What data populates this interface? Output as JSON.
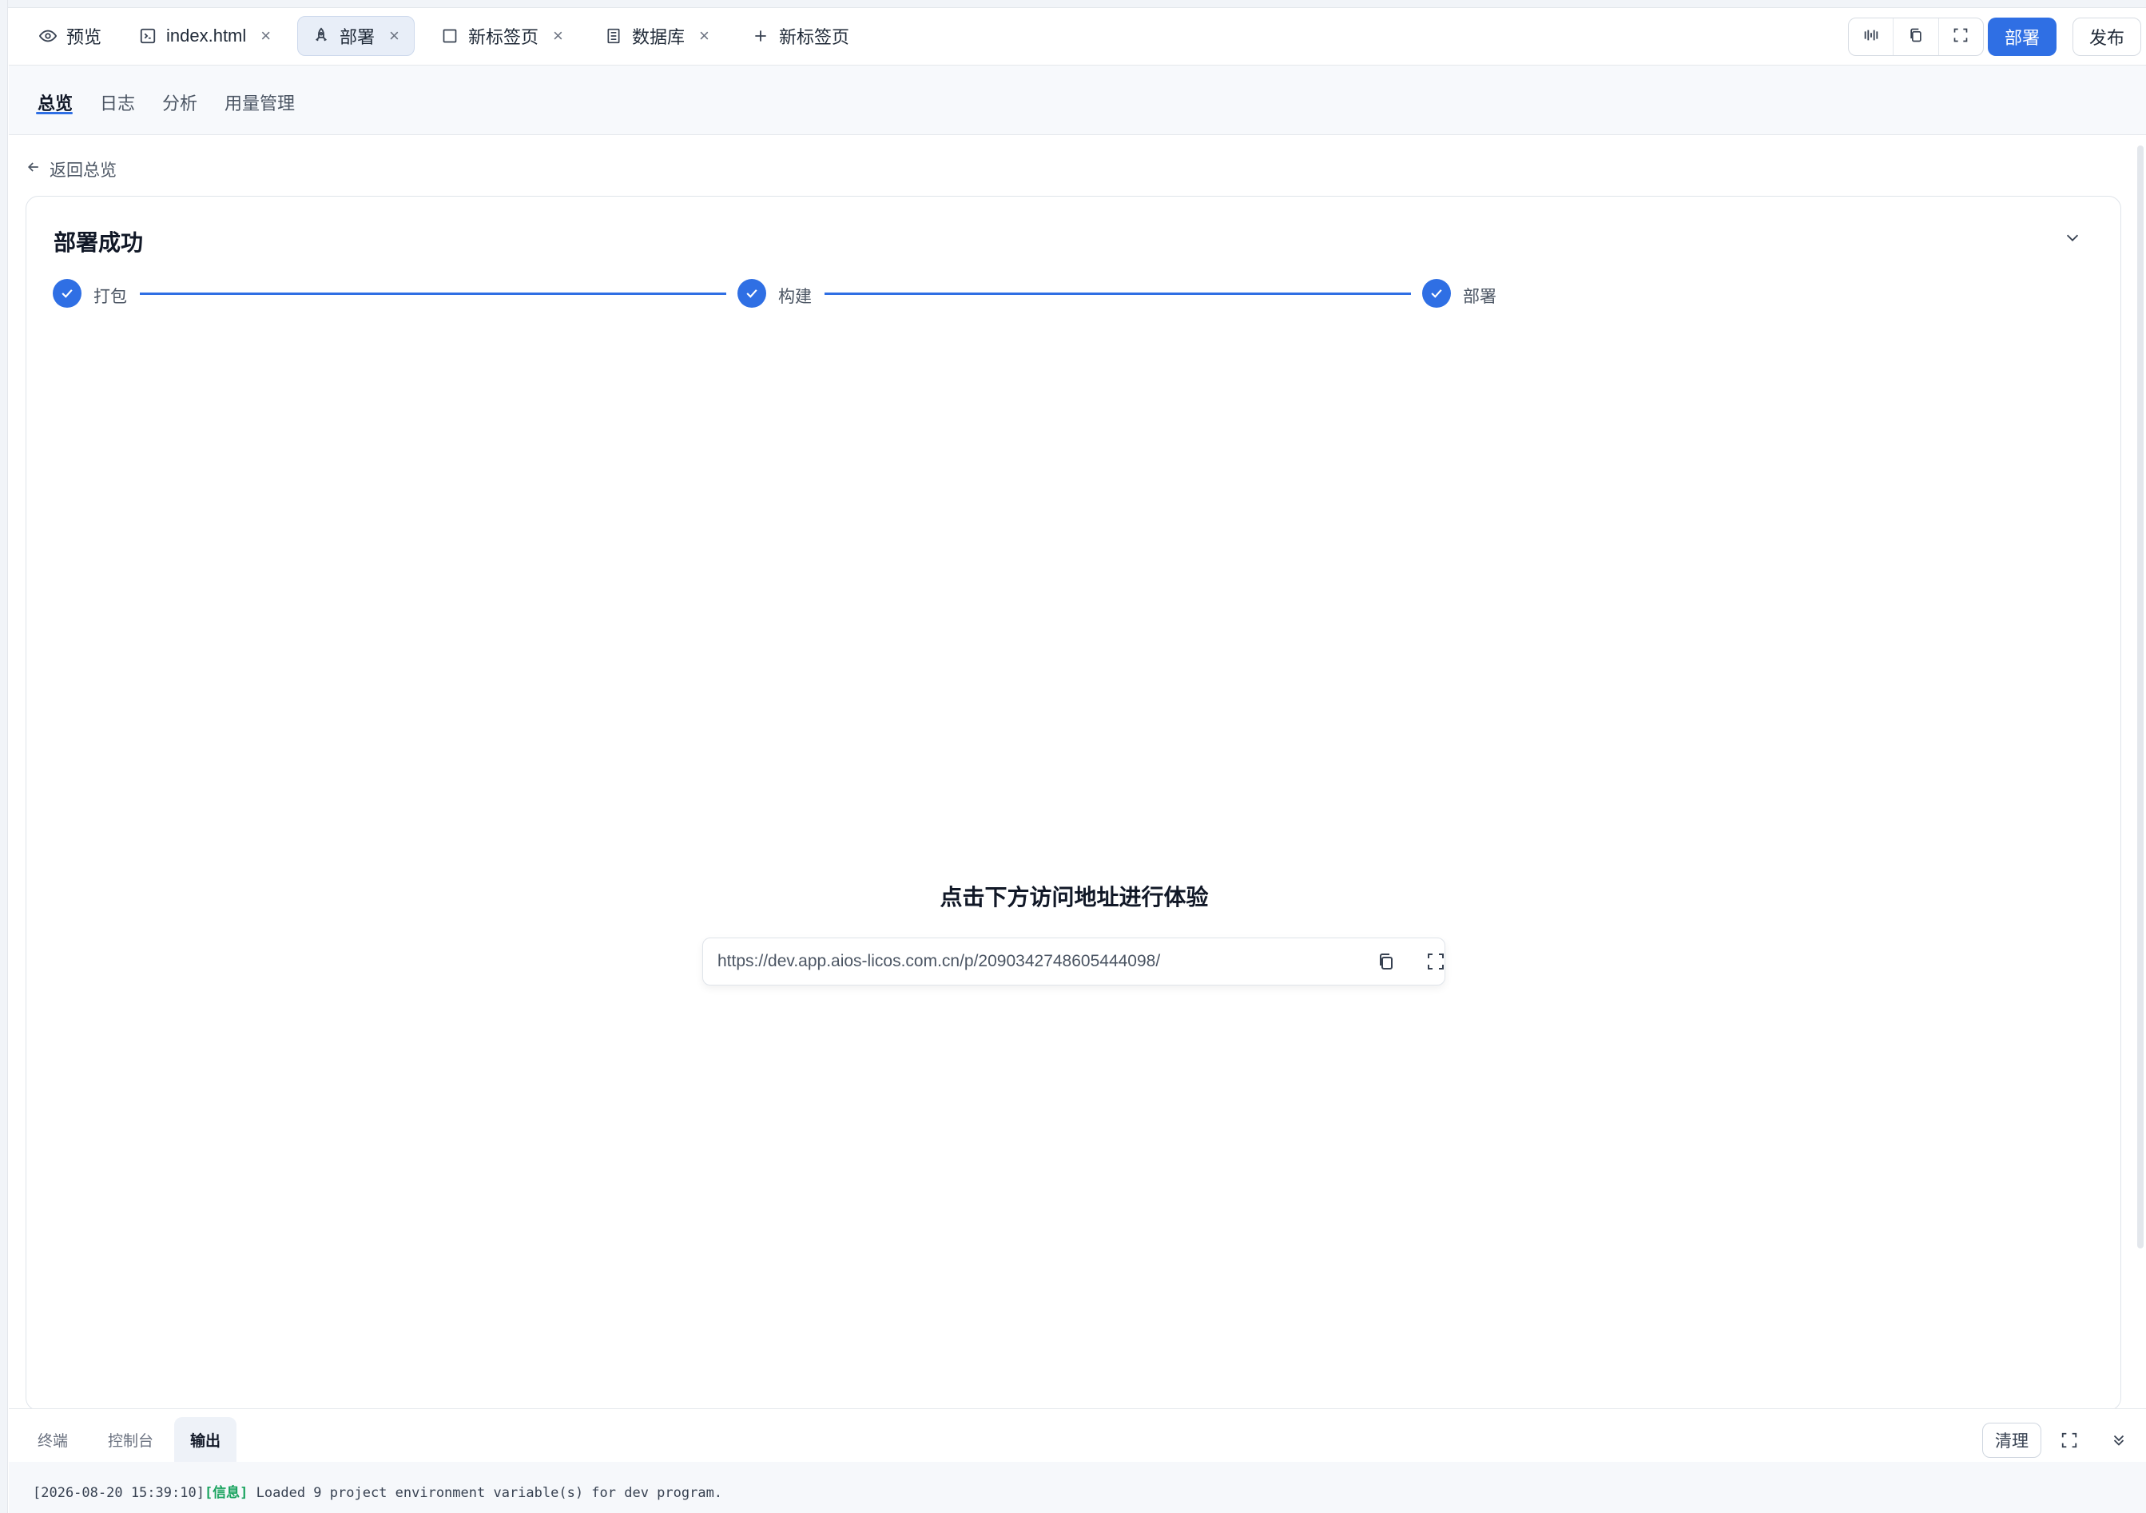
{
  "tabs": [
    {
      "label": "预览",
      "icon": "eye-icon",
      "closable": false,
      "active": false
    },
    {
      "label": "index.html",
      "icon": "terminal-file-icon",
      "closable": true,
      "active": false
    },
    {
      "label": "部署",
      "icon": "rocket-icon",
      "closable": true,
      "active": true
    },
    {
      "label": "新标签页",
      "icon": "square-icon",
      "closable": true,
      "active": false
    },
    {
      "label": "数据库",
      "icon": "database-icon",
      "closable": true,
      "active": false
    }
  ],
  "new_tab_label": "新标签页",
  "toolbar": {
    "tools": [
      "split-icon",
      "copy-icon",
      "fullscreen-icon"
    ],
    "deploy_label": "部署",
    "publish_label": "发布"
  },
  "subnav": {
    "items": [
      "总览",
      "日志",
      "分析",
      "用量管理"
    ],
    "active": "总览"
  },
  "back_label": "返回总览",
  "card": {
    "title": "部署成功",
    "steps": [
      {
        "label": "打包",
        "status": "done"
      },
      {
        "label": "构建",
        "status": "done"
      },
      {
        "label": "部署",
        "status": "done"
      }
    ],
    "hint": "点击下方访问地址进行体验",
    "url": "https://dev.app.aios-licos.com.cn/p/2090342748605444098/"
  },
  "bottom_panel": {
    "tabs": [
      "终端",
      "控制台",
      "输出"
    ],
    "active_tab": "输出",
    "clear_label": "清理",
    "log": {
      "timestamp": "[2026-08-20 15:39:10]",
      "level": "[信息]",
      "message": " Loaded 9 project environment variable(s) for dev program."
    }
  },
  "colors": {
    "accent": "#2f6fe4",
    "success_tag": "#19a35f"
  }
}
